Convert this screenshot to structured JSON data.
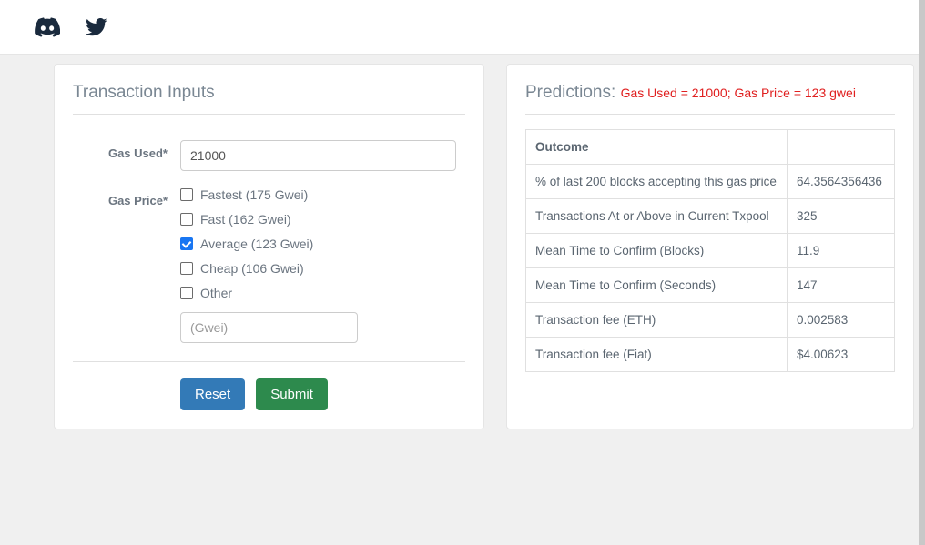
{
  "header": {
    "icons": {
      "discord": "discord",
      "twitter": "twitter"
    }
  },
  "inputs": {
    "title": "Transaction Inputs",
    "gas_used_label": "Gas Used*",
    "gas_used_value": "21000",
    "gas_price_label": "Gas Price*",
    "options": [
      {
        "label": "Fastest (175 Gwei)",
        "checked": false
      },
      {
        "label": "Fast (162 Gwei)",
        "checked": false
      },
      {
        "label": "Average (123 Gwei)",
        "checked": true
      },
      {
        "label": "Cheap (106 Gwei)",
        "checked": false
      },
      {
        "label": "Other",
        "checked": false
      }
    ],
    "other_placeholder": "(Gwei)",
    "reset_label": "Reset",
    "submit_label": "Submit"
  },
  "predictions": {
    "title": "Predictions:",
    "subtitle": "Gas Used = 21000; Gas Price = 123 gwei",
    "outcome_header": "Outcome",
    "rows": [
      {
        "label": "% of last 200 blocks accepting this gas price",
        "value": "64.3564356436"
      },
      {
        "label": "Transactions At or Above in Current Txpool",
        "value": "325"
      },
      {
        "label": "Mean Time to Confirm (Blocks)",
        "value": "11.9"
      },
      {
        "label": "Mean Time to Confirm (Seconds)",
        "value": "147"
      },
      {
        "label": "Transaction fee (ETH)",
        "value": "0.002583"
      },
      {
        "label": "Transaction fee (Fiat)",
        "value": "$4.00623"
      }
    ]
  }
}
